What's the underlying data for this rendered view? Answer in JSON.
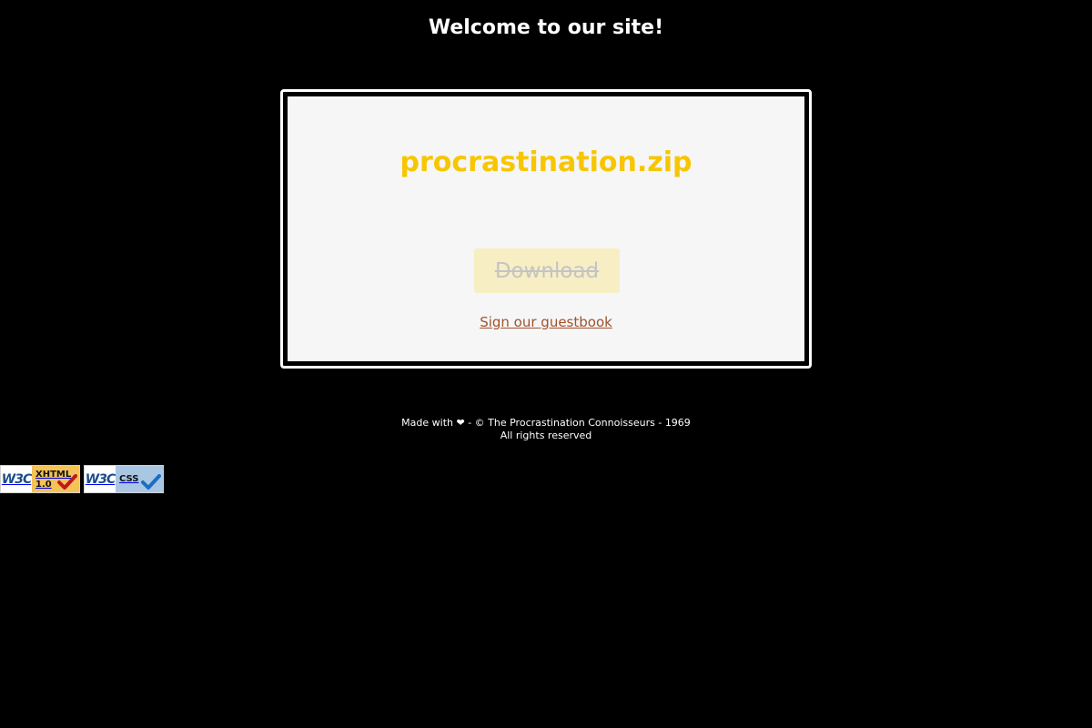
{
  "header": {
    "title": "Welcome to our site!"
  },
  "card": {
    "file_name": "procrastination.zip",
    "download_label": "Download",
    "guestbook_label": "Sign our guestbook"
  },
  "footer": {
    "line1": "Made with ❤ - © The Procrastination Connoisseurs - 1969",
    "line2": "All rights reserved"
  },
  "badges": [
    {
      "logo": "W3C",
      "label_line1": "XHTML",
      "label_line2": "1.0",
      "check_color": "#c4161c",
      "bg_color": "#f3c35a",
      "icon": "check-icon"
    },
    {
      "logo": "W3C",
      "label_line1": "CSS",
      "label_line2": "",
      "check_color": "#1a6fc4",
      "bg_color": "#a9c7e3",
      "icon": "check-icon"
    }
  ],
  "colors": {
    "background": "#000000",
    "title": "#ffffff",
    "file_name": "#f7c600",
    "download_bg": "#f7eec4",
    "download_text": "#c4c4c4",
    "link": "#a0522d"
  }
}
